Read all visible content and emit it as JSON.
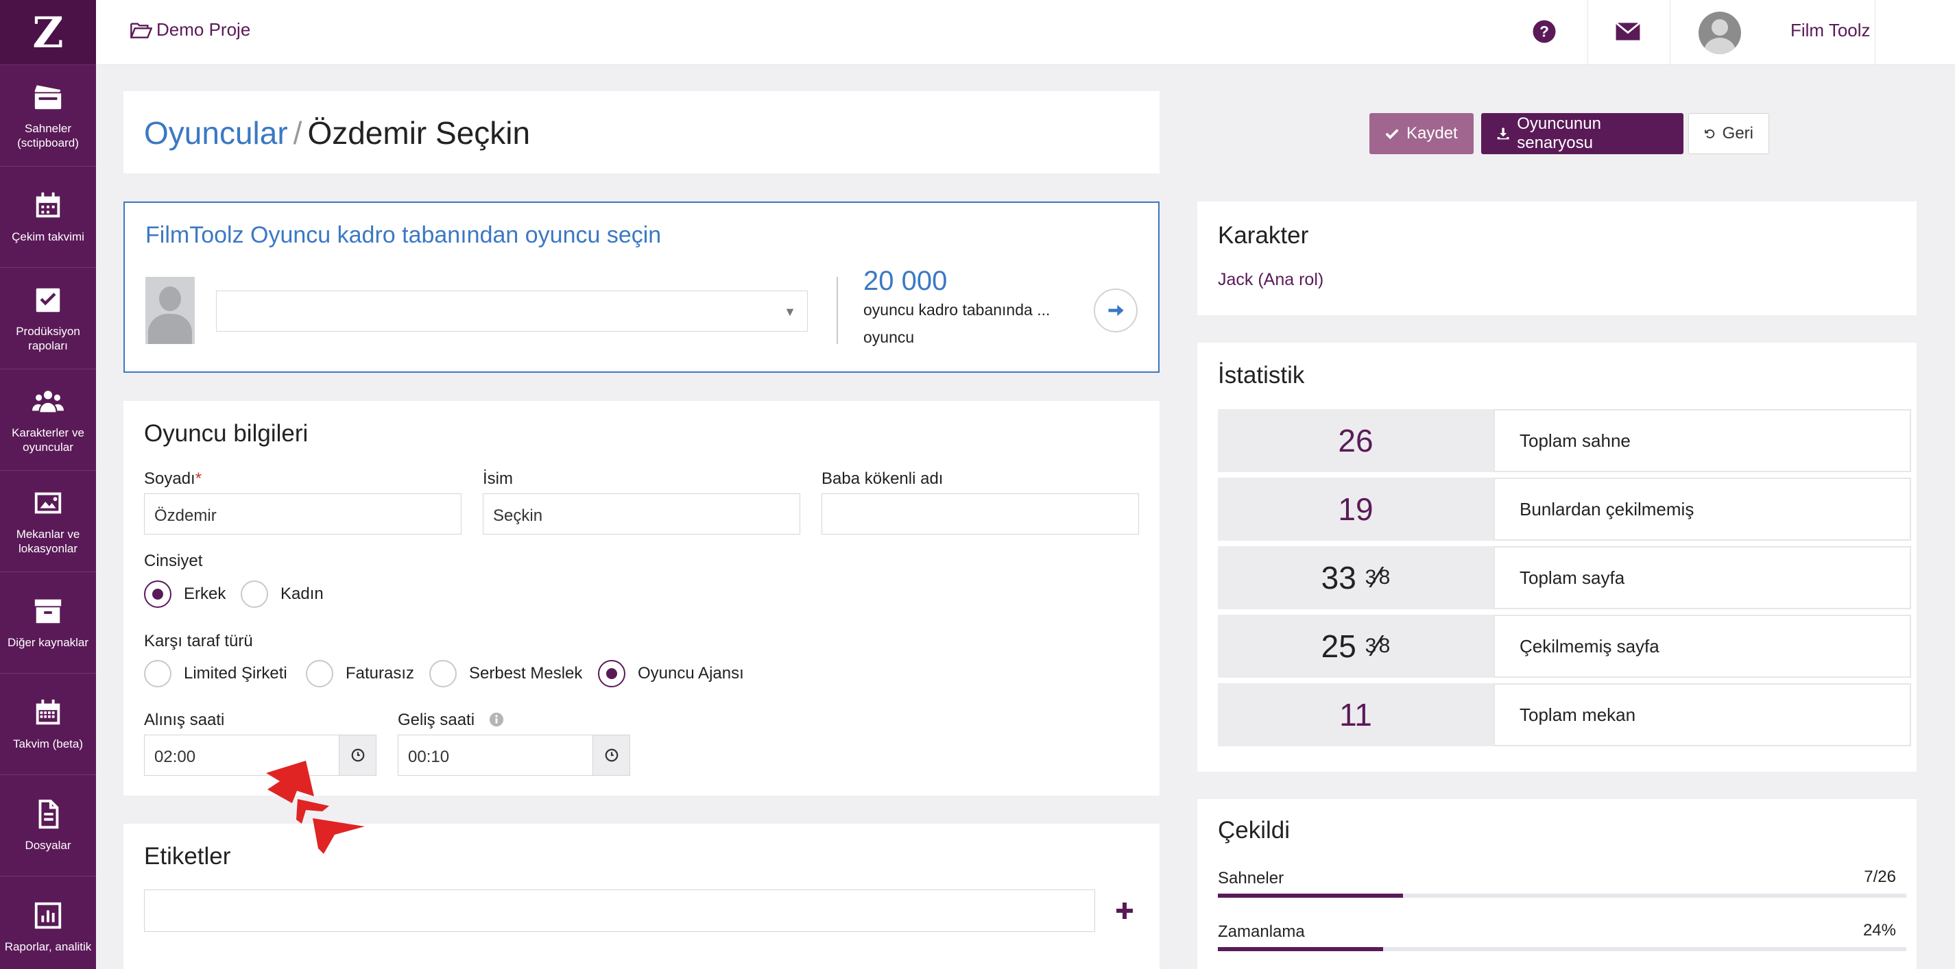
{
  "brand": {
    "accent": "#5a1a57",
    "link": "#3b78c3"
  },
  "sidebar": {
    "logo": "Z",
    "items": [
      {
        "label": "Sahneler (sctipboard)",
        "icon": "clapperboard-icon"
      },
      {
        "label": "Çekim takvimi",
        "icon": "calendar-icon"
      },
      {
        "label": "Prodüksiyon rapoları",
        "icon": "checkbox-icon"
      },
      {
        "label": "Karakterler ve oyuncular",
        "icon": "users-icon"
      },
      {
        "label": "Mekanlar ve lokasyonlar",
        "icon": "image-icon"
      },
      {
        "label": "Diğer kaynaklar",
        "icon": "archive-icon"
      },
      {
        "label": "Takvim (beta)",
        "icon": "calendar-grid-icon"
      },
      {
        "label": "Dosyalar",
        "icon": "file-icon"
      },
      {
        "label": "Raporlar, analitik",
        "icon": "bar-chart-icon"
      }
    ]
  },
  "topbar": {
    "project": "Demo Proje",
    "user_name": "Film Toolz",
    "lang": "TR"
  },
  "header": {
    "breadcrumb_parent": "Oyuncular",
    "separator": "/",
    "title": "Özdemir Seçkin",
    "save_label": "Kaydet",
    "script_label": "Oyuncunun senaryosu",
    "back_label": "Geri"
  },
  "database": {
    "title": "FilmToolz Oyuncu kadro tabanından oyuncu seçin",
    "select_value": "",
    "count": "20 000",
    "count_line1": "oyuncu kadro tabanında ...",
    "count_line2": "oyuncu"
  },
  "info": {
    "title": "Oyuncu bilgileri",
    "surname_label": "Soyadı",
    "required_mark": "*",
    "surname_value": "Özdemir",
    "name_label": "İsim",
    "name_value": "Seçkin",
    "patronymic_label": "Baba kökenli adı",
    "patronymic_value": "",
    "gender_label": "Cinsiyet",
    "gender_options": [
      "Erkek",
      "Kadın"
    ],
    "gender_selected": "Erkek",
    "party_label": "Karşı taraf türü",
    "party_options": [
      "Limited Şirketi",
      "Faturasız",
      "Serbest Meslek",
      "Oyuncu Ajansı"
    ],
    "party_selected": "Oyuncu Ajansı",
    "pickup_label": "Alınış saati",
    "pickup_value": "02:00",
    "arrival_label": "Geliş saati",
    "arrival_value": "00:10"
  },
  "tags": {
    "title": "Etiketler",
    "value": ""
  },
  "character": {
    "title": "Karakter",
    "link": "Jack (Ana rol)"
  },
  "stats": {
    "title": "İstatistik",
    "rows": [
      {
        "value": "26",
        "label": "Toplam sahne"
      },
      {
        "whole": "33",
        "num": "3",
        "den": "8",
        "label": "Toplam sayfa"
      },
      {
        "value": "19",
        "label": "Bunlardan çekilmemiş"
      },
      {
        "whole": "25",
        "num": "3",
        "den": "8",
        "label": "Çekilmemiş sayfa"
      },
      {
        "value": "11",
        "label": "Toplam mekan"
      }
    ]
  },
  "shot": {
    "title": "Çekildi",
    "items": [
      {
        "label": "Sahneler",
        "value": "7/26",
        "fraction": 0.269
      },
      {
        "label": "Zamanlama",
        "value": "24%",
        "fraction": 0.24
      }
    ]
  }
}
